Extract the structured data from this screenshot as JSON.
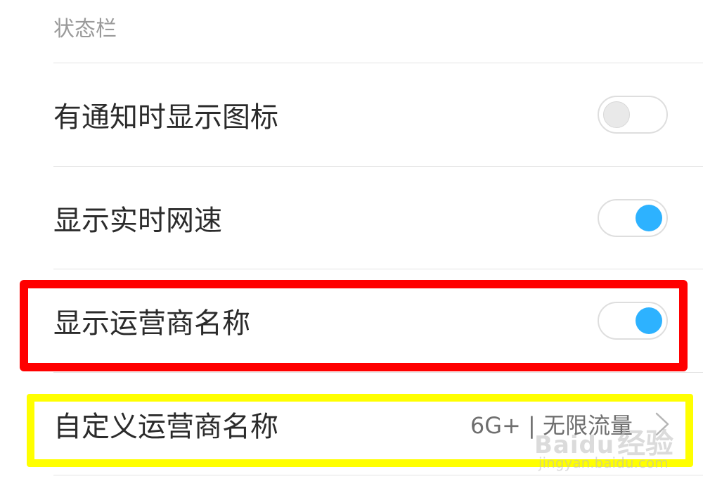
{
  "section": {
    "title": "状态栏"
  },
  "settings": {
    "notification_icons": {
      "label": "有通知时显示图标",
      "enabled": false
    },
    "network_speed": {
      "label": "显示实时网速",
      "enabled": true
    },
    "carrier_name": {
      "label": "显示运营商名称",
      "enabled": true
    },
    "custom_carrier": {
      "label": "自定义运营商名称",
      "value": "6G+ | 无限流量",
      "icon": "chevron-right-icon"
    }
  },
  "colors": {
    "toggle_on": "#2db2ff",
    "highlight_red": "#ff0000",
    "highlight_yellow": "#ffff00"
  },
  "watermark": {
    "brand": "Baidu",
    "sub": "经验",
    "url": "jingyan.baidu.com"
  }
}
